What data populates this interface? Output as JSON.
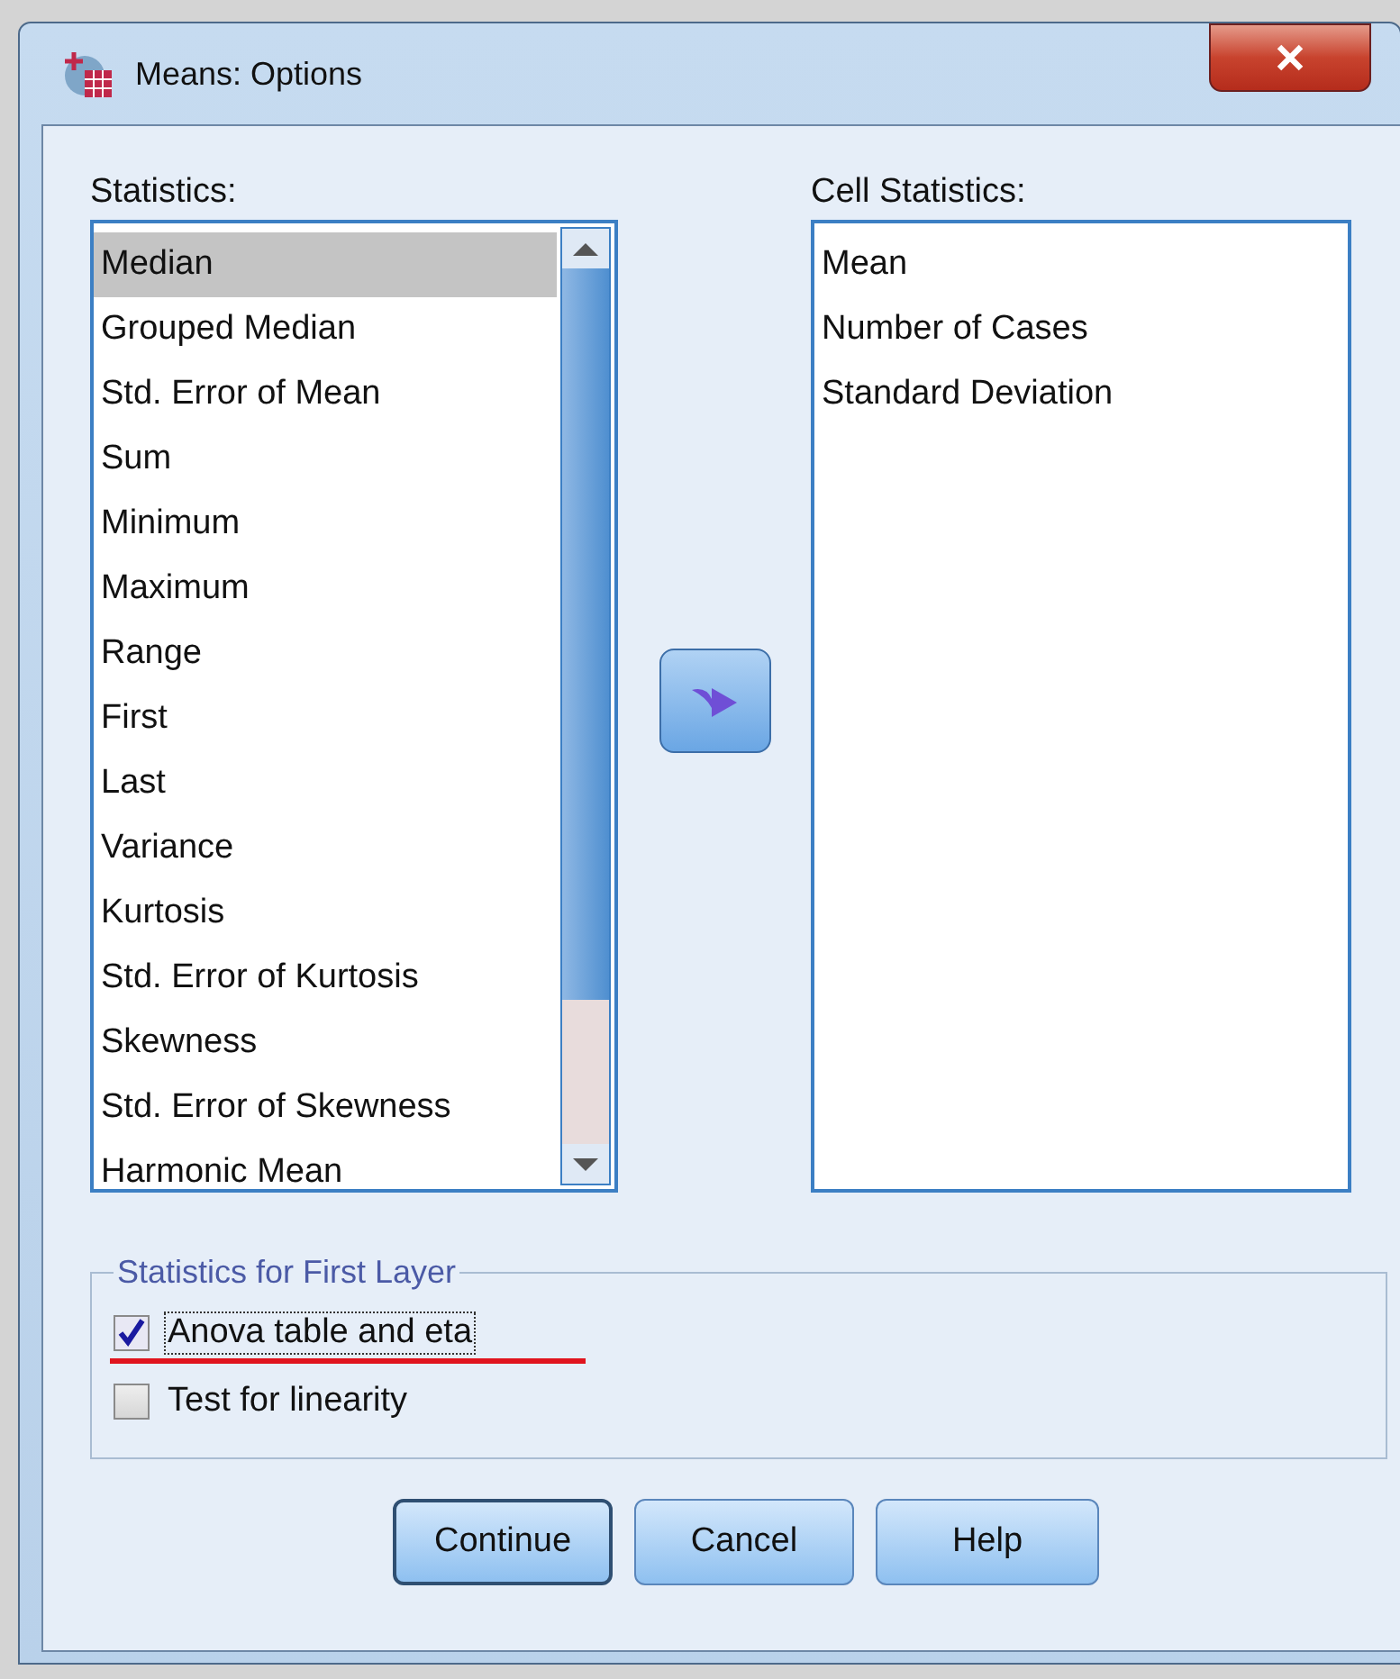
{
  "window": {
    "title": "Means: Options"
  },
  "statistics": {
    "label": "Statistics:",
    "items": [
      {
        "text": "Median",
        "selected": true
      },
      {
        "text": "Grouped Median",
        "selected": false
      },
      {
        "text": "Std. Error of Mean",
        "selected": false
      },
      {
        "text": "Sum",
        "selected": false
      },
      {
        "text": "Minimum",
        "selected": false
      },
      {
        "text": "Maximum",
        "selected": false
      },
      {
        "text": "Range",
        "selected": false
      },
      {
        "text": "First",
        "selected": false
      },
      {
        "text": "Last",
        "selected": false
      },
      {
        "text": "Variance",
        "selected": false
      },
      {
        "text": "Kurtosis",
        "selected": false
      },
      {
        "text": "Std. Error of Kurtosis",
        "selected": false
      },
      {
        "text": "Skewness",
        "selected": false
      },
      {
        "text": "Std. Error of Skewness",
        "selected": false
      },
      {
        "text": "Harmonic Mean",
        "selected": false
      }
    ]
  },
  "cell_statistics": {
    "label": "Cell Statistics:",
    "items": [
      {
        "text": "Mean",
        "selected": false
      },
      {
        "text": "Number of Cases",
        "selected": false
      },
      {
        "text": "Standard Deviation",
        "selected": false
      }
    ]
  },
  "first_layer": {
    "title": "Statistics for First Layer",
    "options": [
      {
        "label": "Anova table and eta",
        "checked": true,
        "focused": true,
        "annotated": true
      },
      {
        "label": "Test for linearity",
        "checked": false,
        "focused": false,
        "annotated": false
      }
    ]
  },
  "buttons": [
    {
      "label": "Continue",
      "default": true
    },
    {
      "label": "Cancel",
      "default": false
    },
    {
      "label": "Help",
      "default": false
    }
  ]
}
